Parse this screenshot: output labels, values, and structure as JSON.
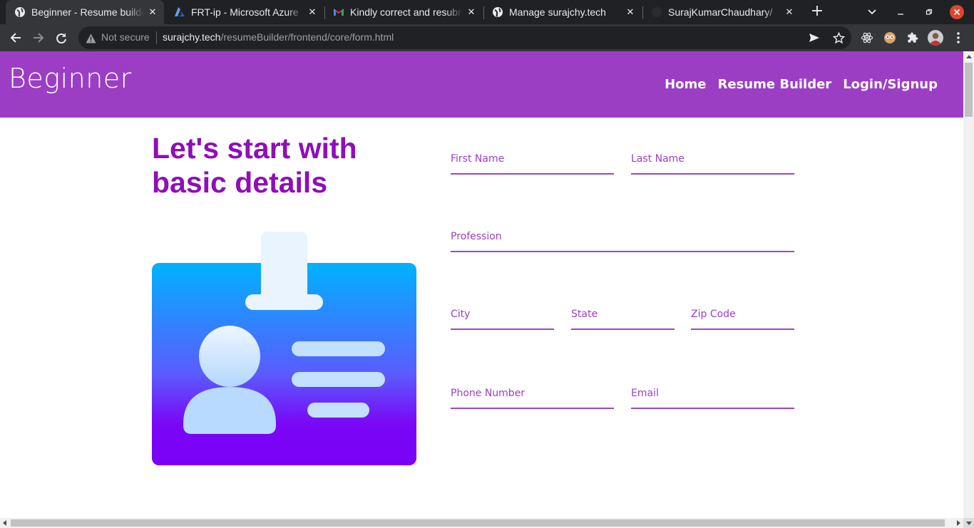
{
  "browser": {
    "tabs": [
      {
        "title": "Beginner - Resume builder",
        "favicon": "globe-icon",
        "active": true
      },
      {
        "title": "FRT-ip - Microsoft Azure",
        "favicon": "azure-icon",
        "active": false
      },
      {
        "title": "Kindly correct and resubmit",
        "favicon": "gmail-icon",
        "active": false
      },
      {
        "title": "Manage surajchy.tech",
        "favicon": "globe-icon",
        "active": false
      },
      {
        "title": "SurajKumarChaudhary/",
        "favicon": "github-icon",
        "active": false
      }
    ],
    "new_tab_label": "+",
    "security_label": "Not secure",
    "url_host": "surajchy.tech",
    "url_path": "/resumeBuilder/frontend/core/form.html"
  },
  "site": {
    "brand": "Beginner",
    "nav": [
      "Home",
      "Resume Builder",
      "Login/Signup"
    ],
    "accent_color": "#9c3ec4",
    "heading_color": "#8e0fb8"
  },
  "form": {
    "heading": "Let's start with basic details",
    "fields": {
      "first_name": "First Name",
      "last_name": "Last Name",
      "profession": "Profession",
      "city": "City",
      "state": "State",
      "zip": "Zip Code",
      "phone": "Phone Number",
      "email": "Email"
    }
  },
  "illustration": {
    "icon": "id-badge-icon",
    "gradient_top": "#00b0ff",
    "gradient_bottom": "#7a00f5",
    "foreground": "#e8f3ff"
  }
}
